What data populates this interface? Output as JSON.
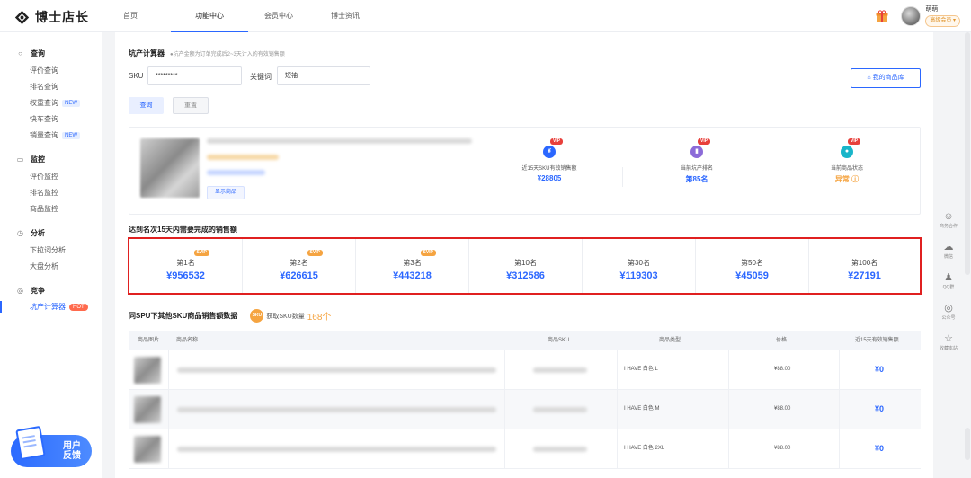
{
  "app": {
    "logo_text": "博士店长"
  },
  "nav": [
    {
      "label": "首页"
    },
    {
      "label": "功能中心"
    },
    {
      "label": "会员中心"
    },
    {
      "label": "博士资讯"
    }
  ],
  "user": {
    "name": "萌萌",
    "level": "高级会员 ▾"
  },
  "sidebar": {
    "groups": [
      {
        "title": "查询",
        "icon": "search-icon",
        "items": [
          {
            "label": "评价查询"
          },
          {
            "label": "排名查询"
          },
          {
            "label": "权重查询",
            "tag": "NEW"
          },
          {
            "label": "快车查询"
          },
          {
            "label": "销量查询",
            "tag": "NEW"
          }
        ]
      },
      {
        "title": "监控",
        "icon": "monitor-icon",
        "items": [
          {
            "label": "评价监控"
          },
          {
            "label": "排名监控"
          },
          {
            "label": "商品监控"
          }
        ]
      },
      {
        "title": "分析",
        "icon": "clock-icon",
        "items": [
          {
            "label": "下拉词分析"
          },
          {
            "label": "大盘分析"
          }
        ]
      },
      {
        "title": "竞争",
        "icon": "target-icon",
        "items": [
          {
            "label": "坑产计算器",
            "tag": "HOT",
            "active": true
          }
        ]
      }
    ],
    "feedback_line1": "用户",
    "feedback_line2": "反馈"
  },
  "page": {
    "title": "坑产计算器",
    "subtitle": "●坑产金额为订单完成后2~3天计入的有效销售额",
    "sku_label": "SKU",
    "sku_value": "*********",
    "keyword_label": "关键词",
    "keyword_value": "短袖",
    "query_button": "查询",
    "reset_button": "重置",
    "my_products_button": "我的商品库",
    "show_product_button": "显示商品"
  },
  "stats": [
    {
      "label": "近15天SKU有效销售额",
      "value": "¥28805",
      "vip": "VIP",
      "icon_color": "#2b67ff",
      "icon_glyph": "¥",
      "value_color": "#2b67ff"
    },
    {
      "label": "当前坑产排名",
      "value": "第85名",
      "vip": "VIP",
      "icon_color": "#8c6bd8",
      "icon_glyph": "▮",
      "value_color": "#2b67ff"
    },
    {
      "label": "当前商品状态",
      "value": "异常 ⓘ",
      "vip": "VIP",
      "icon_color": "#19b5c9",
      "icon_glyph": "●",
      "value_color": "#f5a441"
    }
  ],
  "ranking": {
    "section_title": "达到名次15天内需要完成的销售额",
    "cells": [
      {
        "label": "第1名",
        "value": "¥956532",
        "vip": "SVIP"
      },
      {
        "label": "第2名",
        "value": "¥626615",
        "vip": "SVIP"
      },
      {
        "label": "第3名",
        "value": "¥443218",
        "vip": "SVIP"
      },
      {
        "label": "第10名",
        "value": "¥312586",
        "vip": ""
      },
      {
        "label": "第30名",
        "value": "¥119303",
        "vip": ""
      },
      {
        "label": "第50名",
        "value": "¥45059",
        "vip": ""
      },
      {
        "label": "第100名",
        "value": "¥27191",
        "vip": ""
      }
    ]
  },
  "spu": {
    "title": "同SPU下其他SKU商品销售额数据",
    "badge": "SKU",
    "count_label": "获取SKU数量",
    "count_value": "168个"
  },
  "table": {
    "headers": [
      "商品图片",
      "商品名称",
      "商品SKU",
      "商品类型",
      "价格",
      "近15天有效销售额"
    ],
    "rows": [
      {
        "type": "I HAVE 白色  L",
        "price": "¥88.00",
        "sales": "¥0"
      },
      {
        "type": "I HAVE 白色  M",
        "price": "¥88.00",
        "sales": "¥0"
      },
      {
        "type": "I HAVE 白色  2XL",
        "price": "¥88.00",
        "sales": "¥0"
      }
    ]
  },
  "float_bar": [
    {
      "icon": "handshake-icon",
      "glyph": "☺",
      "label": "商务合作"
    },
    {
      "icon": "wechat-icon",
      "glyph": "☁",
      "label": "微信"
    },
    {
      "icon": "qq-icon",
      "glyph": "♟",
      "label": "QQ群"
    },
    {
      "icon": "official-account-icon",
      "glyph": "◎",
      "label": "公众号"
    },
    {
      "icon": "star-icon",
      "glyph": "☆",
      "label": "收藏本站"
    }
  ]
}
